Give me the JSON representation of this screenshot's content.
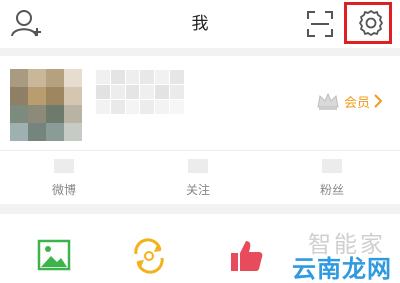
{
  "header": {
    "title": "我",
    "left_icon": "add-friend-icon",
    "scan_icon": "scan-icon",
    "settings_icon": "gear-icon"
  },
  "profile": {
    "vip_label": "会员",
    "vip_icon": "crown-icon"
  },
  "stats": [
    {
      "label": "微博"
    },
    {
      "label": "关注"
    },
    {
      "label": "粉丝"
    }
  ],
  "tools": [
    {
      "icon": "photo-icon"
    },
    {
      "icon": "refresh-icon"
    },
    {
      "icon": "thumbs-up-icon"
    }
  ],
  "watermark": {
    "top": "智能家",
    "bottom": "云南龙网"
  },
  "colors": {
    "accent_orange": "#f39a1a",
    "highlight_red": "#e02020",
    "photo_green": "#3cb44b",
    "refresh_yellow": "#f2b21c",
    "like_red": "#e84c5c"
  }
}
